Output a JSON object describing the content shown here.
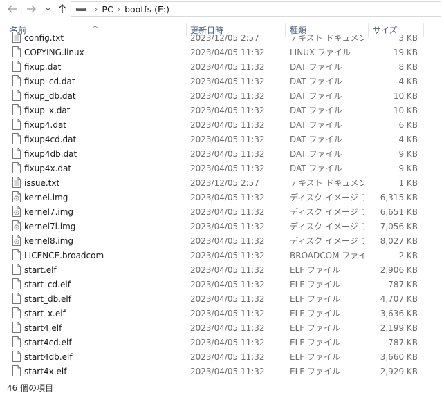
{
  "window": {
    "breadcrumb": [
      "PC",
      "bootfs (E:)"
    ],
    "drive_icon": "drive-icon"
  },
  "columns": {
    "name": "名前",
    "date": "更新日時",
    "type": "種類",
    "size": "サイズ"
  },
  "files": [
    {
      "name": "config.txt",
      "date": "2023/12/05 2:57",
      "type": "テキスト ドキュメント",
      "size": "3 KB",
      "icon": "text-file-icon"
    },
    {
      "name": "COPYING.linux",
      "date": "2023/04/05 11:32",
      "type": "LINUX ファイル",
      "size": "19 KB",
      "icon": "file-icon"
    },
    {
      "name": "fixup.dat",
      "date": "2023/04/05 11:32",
      "type": "DAT ファイル",
      "size": "8 KB",
      "icon": "file-icon"
    },
    {
      "name": "fixup_cd.dat",
      "date": "2023/04/05 11:32",
      "type": "DAT ファイル",
      "size": "4 KB",
      "icon": "file-icon"
    },
    {
      "name": "fixup_db.dat",
      "date": "2023/04/05 11:32",
      "type": "DAT ファイル",
      "size": "10 KB",
      "icon": "file-icon"
    },
    {
      "name": "fixup_x.dat",
      "date": "2023/04/05 11:32",
      "type": "DAT ファイル",
      "size": "10 KB",
      "icon": "file-icon"
    },
    {
      "name": "fixup4.dat",
      "date": "2023/04/05 11:32",
      "type": "DAT ファイル",
      "size": "6 KB",
      "icon": "file-icon"
    },
    {
      "name": "fixup4cd.dat",
      "date": "2023/04/05 11:32",
      "type": "DAT ファイル",
      "size": "4 KB",
      "icon": "file-icon"
    },
    {
      "name": "fixup4db.dat",
      "date": "2023/04/05 11:32",
      "type": "DAT ファイル",
      "size": "9 KB",
      "icon": "file-icon"
    },
    {
      "name": "fixup4x.dat",
      "date": "2023/04/05 11:32",
      "type": "DAT ファイル",
      "size": "9 KB",
      "icon": "file-icon"
    },
    {
      "name": "issue.txt",
      "date": "2023/12/05 2:57",
      "type": "テキスト ドキュメント",
      "size": "1 KB",
      "icon": "text-file-icon"
    },
    {
      "name": "kernel.img",
      "date": "2023/04/05 11:32",
      "type": "ディスク イメージ ファ...",
      "size": "6,315 KB",
      "icon": "disk-image-icon"
    },
    {
      "name": "kernel7.img",
      "date": "2023/04/05 11:32",
      "type": "ディスク イメージ ファ...",
      "size": "6,651 KB",
      "icon": "disk-image-icon"
    },
    {
      "name": "kernel7l.img",
      "date": "2023/04/05 11:32",
      "type": "ディスク イメージ ファ...",
      "size": "7,056 KB",
      "icon": "disk-image-icon"
    },
    {
      "name": "kernel8.img",
      "date": "2023/04/05 11:32",
      "type": "ディスク イメージ ファ...",
      "size": "8,027 KB",
      "icon": "disk-image-icon"
    },
    {
      "name": "LICENCE.broadcom",
      "date": "2023/04/05 11:32",
      "type": "BROADCOM ファイル",
      "size": "2 KB",
      "icon": "file-icon"
    },
    {
      "name": "start.elf",
      "date": "2023/04/05 11:32",
      "type": "ELF ファイル",
      "size": "2,906 KB",
      "icon": "file-icon"
    },
    {
      "name": "start_cd.elf",
      "date": "2023/04/05 11:32",
      "type": "ELF ファイル",
      "size": "787 KB",
      "icon": "file-icon"
    },
    {
      "name": "start_db.elf",
      "date": "2023/04/05 11:32",
      "type": "ELF ファイル",
      "size": "4,707 KB",
      "icon": "file-icon"
    },
    {
      "name": "start_x.elf",
      "date": "2023/04/05 11:32",
      "type": "ELF ファイル",
      "size": "3,636 KB",
      "icon": "file-icon"
    },
    {
      "name": "start4.elf",
      "date": "2023/04/05 11:32",
      "type": "ELF ファイル",
      "size": "2,199 KB",
      "icon": "file-icon"
    },
    {
      "name": "start4cd.elf",
      "date": "2023/04/05 11:32",
      "type": "ELF ファイル",
      "size": "787 KB",
      "icon": "file-icon"
    },
    {
      "name": "start4db.elf",
      "date": "2023/04/05 11:32",
      "type": "ELF ファイル",
      "size": "3,660 KB",
      "icon": "file-icon"
    },
    {
      "name": "start4x.elf",
      "date": "2023/04/05 11:32",
      "type": "ELF ファイル",
      "size": "2,929 KB",
      "icon": "file-icon"
    }
  ],
  "status": {
    "item_count": "46 個の項目"
  }
}
